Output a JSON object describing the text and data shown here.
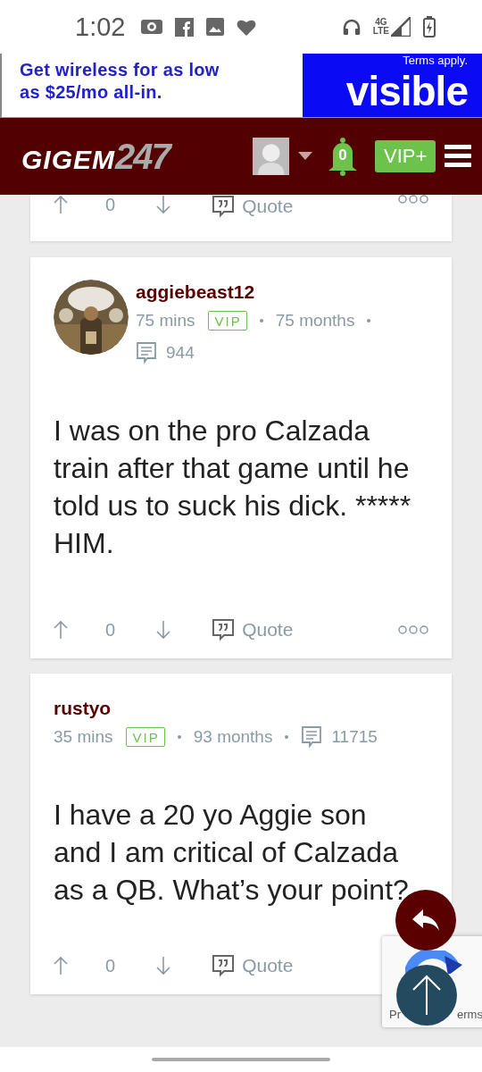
{
  "status_bar": {
    "time": "1:02",
    "network": "4G",
    "network_sub": "LTE"
  },
  "ad": {
    "text": "Get wireless for as low as $25/mo all-in.",
    "fine_print": "Terms apply.",
    "brand": "visible"
  },
  "header": {
    "logo_main": "GIGEM",
    "logo_num": "247",
    "notifications": "0",
    "vip_button": "VIP+"
  },
  "posts": [
    {
      "kind": "actions_only",
      "votes": "0",
      "quote": "Quote",
      "more_button": true
    },
    {
      "kind": "full",
      "has_avatar": true,
      "username": "aggiebeast12",
      "time": "75 mins",
      "badge": "VIP",
      "tenure": "75 months",
      "comments": "944",
      "body": "I was on the pro Calzada train after that game until he told us to suck his dick. ***** HIM.",
      "votes": "0",
      "quote": "Quote",
      "more_button": true
    },
    {
      "kind": "full",
      "has_avatar": false,
      "username": "rustyo",
      "time": "35 mins",
      "badge": "VIP",
      "tenure": "93 months",
      "comments": "11715",
      "body": "I have a 20 yo Aggie son and I am critical of Calzada as a QB. What’s your point?",
      "votes": "0",
      "quote": "Quote",
      "more_button": false
    }
  ],
  "recaptcha": {
    "text_left": "Pr",
    "text_right": "erms"
  }
}
